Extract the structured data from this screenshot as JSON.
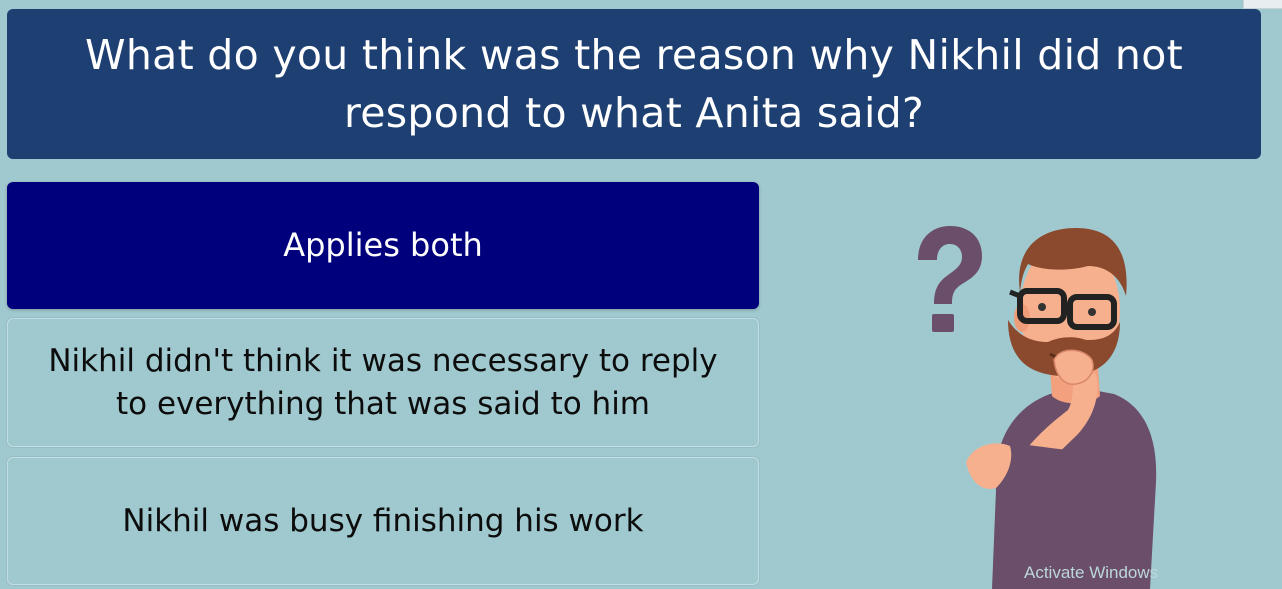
{
  "question": {
    "text": "What do you think was the reason why Nikhil did not respond to what Anita said?"
  },
  "options": [
    {
      "label": "Applies both",
      "selected": true
    },
    {
      "label": "Nikhil didn't think it was necessary to reply to everything that was said to him",
      "selected": false
    },
    {
      "label": "Nikhil was busy finishing his work",
      "selected": false
    }
  ],
  "illustration": {
    "icon": "thinking-man-question-mark-icon"
  },
  "watermark": {
    "text": "Activate Windows"
  },
  "colors": {
    "background": "#a0c9cf",
    "question_box": "#1e3f72",
    "selected_option": "#00007c",
    "shirt": "#6a4e6a",
    "question_mark": "#6a4e6a"
  }
}
